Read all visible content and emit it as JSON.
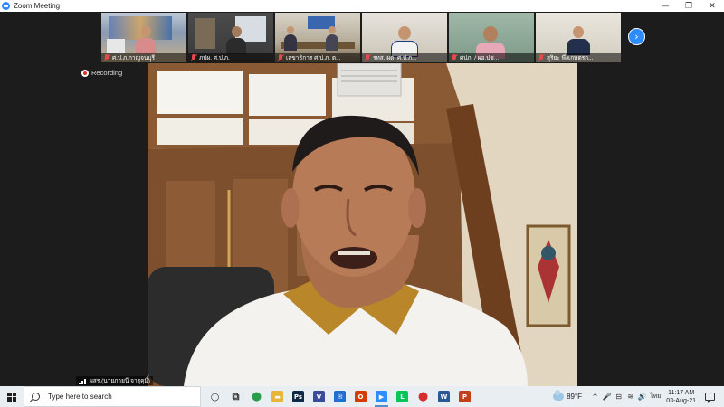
{
  "window": {
    "title": "Zoom Meeting",
    "controls": {
      "minimize": "—",
      "maximize": "❐",
      "close": "✕"
    }
  },
  "participants": [
    {
      "name": "ศ.ป.ภ.กาญจนบุรี",
      "muted": true
    },
    {
      "name": "ภปผ. ศ.ป.ภ.",
      "muted": true
    },
    {
      "name": "เลขาธิการ ศ.ป.ภ. ต...",
      "muted": true
    },
    {
      "name": "รทส. ผต. ศ.ป.ภ...",
      "muted": true
    },
    {
      "name": "ศปภ. / ผอ.ปช...",
      "muted": true
    },
    {
      "name": "สุริยะ พึ่งเกษตรก...",
      "muted": true
    }
  ],
  "next_button": "›",
  "recording": {
    "label": "Recording"
  },
  "speaker": {
    "name": "ผสร.(นายภายนี จารุคุมิ์)"
  },
  "taskbar": {
    "search_placeholder": "Type here to search",
    "apps": [
      {
        "name": "task-view",
        "glyph": "○",
        "color": "#333333"
      },
      {
        "name": "task-switch",
        "glyph": "⧉",
        "color": "#333333"
      },
      {
        "name": "chrome",
        "glyph": "●",
        "color": "#2a9d4a"
      },
      {
        "name": "file-explorer",
        "glyph": "▬",
        "color": "#e8b43a"
      },
      {
        "name": "photoshop",
        "glyph": "Ps",
        "color": "#0e2a47"
      },
      {
        "name": "vivaldi",
        "glyph": "V",
        "color": "#3b4b9b"
      },
      {
        "name": "mail",
        "glyph": "✉",
        "color": "#1f6fd1"
      },
      {
        "name": "office",
        "glyph": "O",
        "color": "#d83b01"
      },
      {
        "name": "zoom",
        "glyph": "▶",
        "color": "#2d8cff"
      },
      {
        "name": "line",
        "glyph": "L",
        "color": "#06c755"
      },
      {
        "name": "red-app",
        "glyph": "●",
        "color": "#d32f2f"
      },
      {
        "name": "word",
        "glyph": "W",
        "color": "#2b5797"
      },
      {
        "name": "powerpoint",
        "glyph": "P",
        "color": "#c43e1c"
      }
    ],
    "weather": {
      "temp": "89°F"
    },
    "tray_icons": [
      "^",
      "🎤",
      "⊟",
      "≋",
      "🔊"
    ],
    "language": "ไทย",
    "clock": {
      "time": "11:17 AM",
      "date": "03-Aug-21"
    }
  }
}
